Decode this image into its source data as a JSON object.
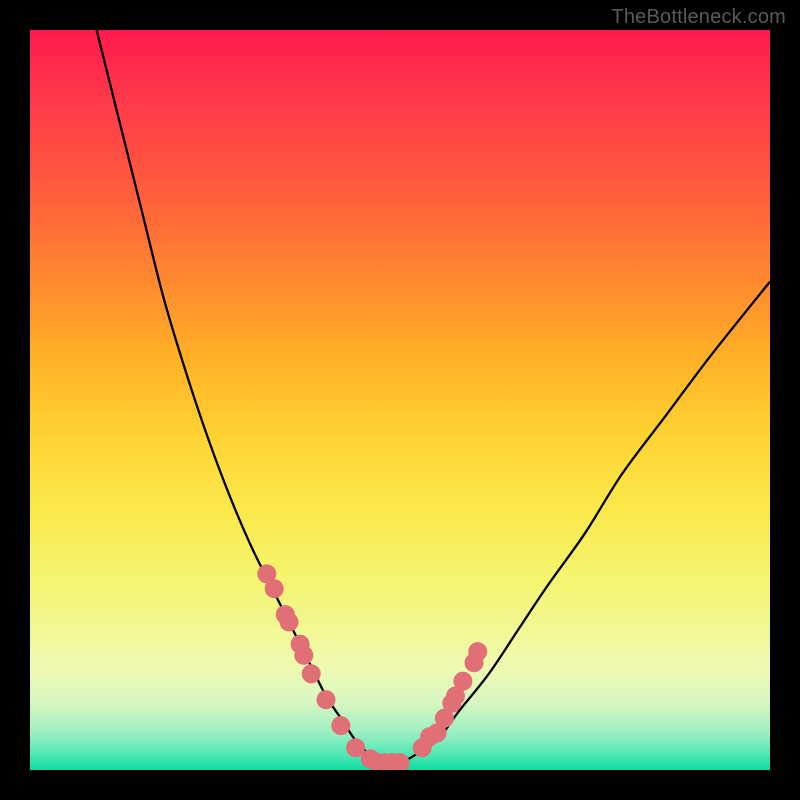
{
  "watermark": "TheBottleneck.com",
  "colors": {
    "background": "#000000",
    "curve": "#000000",
    "marker": "#e06f76",
    "gradient_top": "#ff1a4d",
    "gradient_bottom": "#0ddca0"
  },
  "chart_data": {
    "type": "line",
    "title": "",
    "xlabel": "",
    "ylabel": "",
    "xlim": [
      0,
      100
    ],
    "ylim": [
      0,
      100
    ],
    "grid": false,
    "legend": false,
    "series": [
      {
        "name": "bottleneck-curve",
        "x": [
          9,
          12,
          15,
          18,
          21,
          24,
          27,
          30,
          33,
          36,
          38,
          40,
          42,
          44,
          46,
          48,
          50,
          52,
          55,
          58,
          62,
          66,
          70,
          75,
          80,
          86,
          92,
          100
        ],
        "y": [
          100,
          88,
          76,
          64,
          54,
          45,
          37,
          30,
          24,
          18,
          14,
          10,
          7,
          4,
          2,
          1,
          1,
          2,
          4,
          8,
          13,
          19,
          25,
          32,
          40,
          48,
          56,
          66
        ]
      }
    ],
    "markers": {
      "name": "highlight-points",
      "x": [
        32,
        33,
        34.5,
        35,
        36.5,
        37,
        38,
        40,
        42,
        44,
        46,
        47,
        48,
        49,
        50,
        53,
        54,
        55,
        56,
        57,
        57.5,
        58.5,
        60,
        60.5
      ],
      "y": [
        26.5,
        24.5,
        21,
        20,
        17,
        15.5,
        13,
        9.5,
        6,
        3,
        1.5,
        1,
        1,
        1,
        1,
        3,
        4.5,
        5,
        7,
        9,
        10,
        12,
        14.5,
        16
      ]
    }
  }
}
